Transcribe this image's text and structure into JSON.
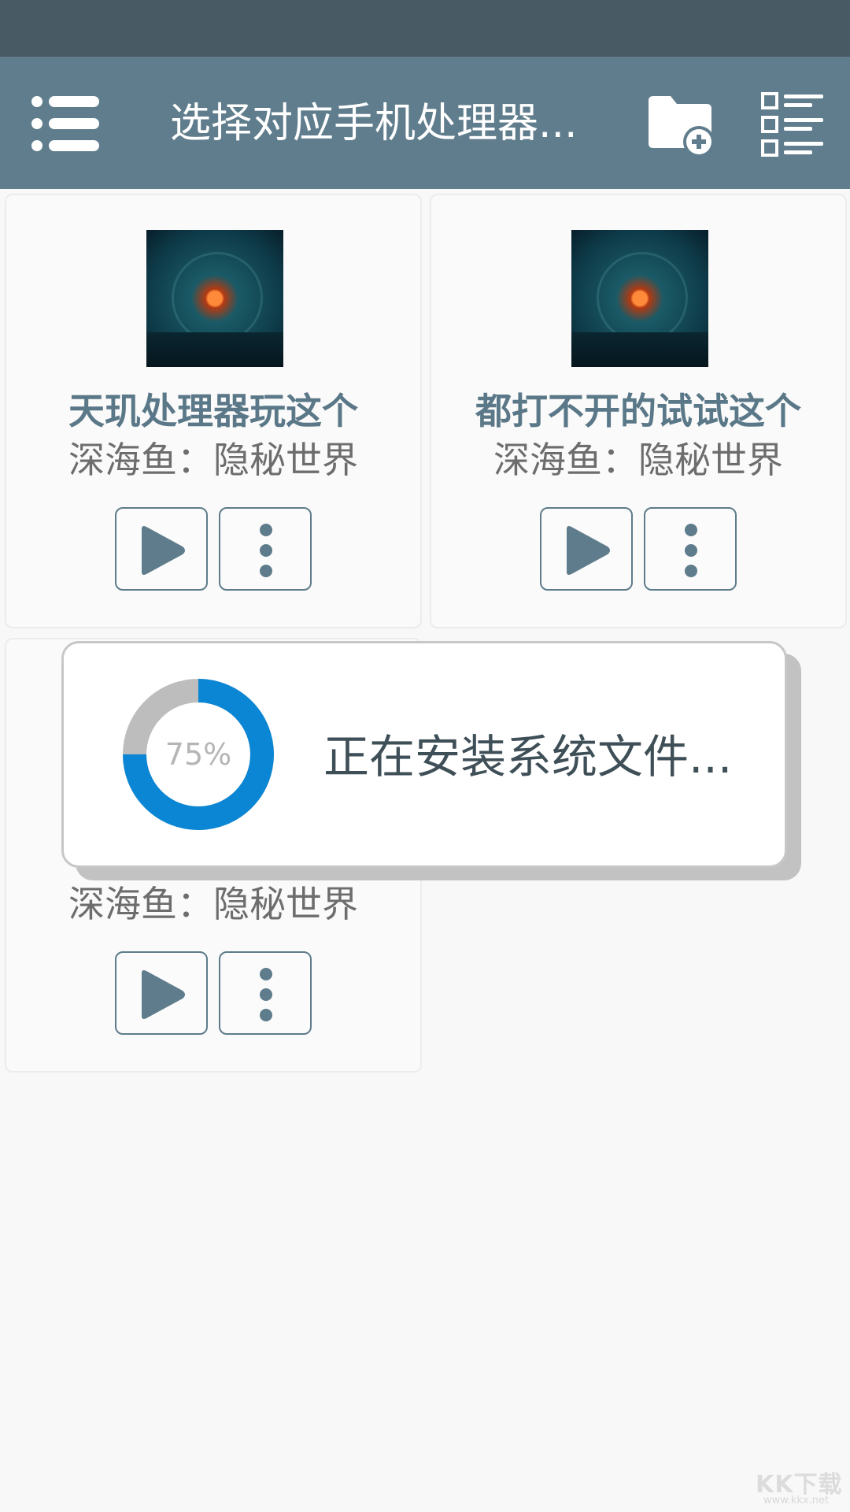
{
  "toolbar": {
    "title": "选择对应手机处理器...",
    "menu_icon": "menu-list-icon",
    "folder_icon": "folder-add-icon",
    "view_icon": "checklist-view-icon"
  },
  "cards": [
    {
      "title": "天玑处理器玩这个",
      "subtitle": "深海鱼：隐秘世界"
    },
    {
      "title": "都打不开的试试这个",
      "subtitle": "深海鱼：隐秘世界"
    },
    {
      "title": "",
      "subtitle": "深海鱼：隐秘世界"
    }
  ],
  "dialog": {
    "progress_label": "75%",
    "progress_value": 0.75,
    "message": "正在安装系统文件...",
    "progress_color": "#0a86d4",
    "track_color": "#bdbdbd"
  },
  "watermark": {
    "text": "KK下载",
    "url": "www.kkx.net"
  },
  "colors": {
    "status_bar": "#485a64",
    "toolbar": "#5f7d8c",
    "accent": "#5e7c8b"
  }
}
